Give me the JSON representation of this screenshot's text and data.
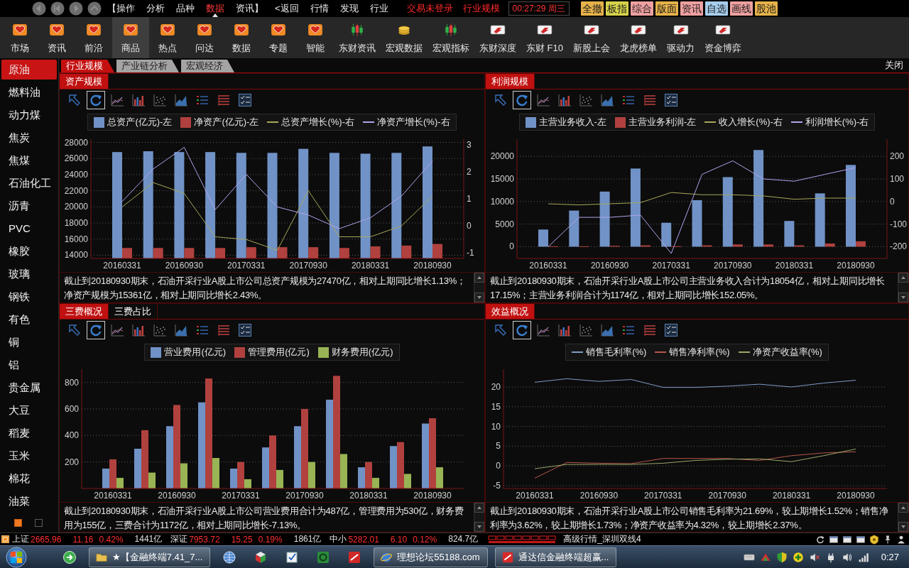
{
  "menubar": {
    "menu": [
      {
        "label": "【操作",
        "selected": false
      },
      {
        "label": "分析",
        "selected": false
      },
      {
        "label": "品种",
        "selected": false
      },
      {
        "label": "数据",
        "selected": true
      },
      {
        "label": "资讯】",
        "selected": false
      },
      {
        "label": "<返回",
        "selected": false
      },
      {
        "label": "行情",
        "selected": false
      },
      {
        "label": "发现",
        "selected": false
      },
      {
        "label": "行业",
        "selected": false
      }
    ],
    "alerts": [
      "交易未登录",
      "行业规模"
    ],
    "clock": "00:27:29 周三",
    "quick_buttons": [
      {
        "label": "全撤",
        "color": "#e6b24a"
      },
      {
        "label": "板指",
        "color": "#d6d24a"
      },
      {
        "label": "综合",
        "color": "#eea0a0"
      },
      {
        "label": "版面",
        "color": "#e6b24a"
      },
      {
        "label": "资讯",
        "color": "#eea0a0"
      },
      {
        "label": "自选",
        "color": "#a6cdec"
      },
      {
        "label": "画线",
        "color": "#eea0a0"
      },
      {
        "label": "股池",
        "color": "#e6b24a"
      }
    ]
  },
  "toolbar": [
    {
      "label": "市场",
      "kind": "module",
      "selected": false
    },
    {
      "label": "资讯",
      "kind": "module",
      "selected": false
    },
    {
      "label": "前沿",
      "kind": "module",
      "selected": false
    },
    {
      "label": "商品",
      "kind": "module",
      "selected": true
    },
    {
      "label": "热点",
      "kind": "module",
      "selected": false
    },
    {
      "label": "问达",
      "kind": "module",
      "selected": false
    },
    {
      "label": "数据",
      "kind": "module",
      "selected": false
    },
    {
      "label": "专题",
      "kind": "module",
      "selected": false
    },
    {
      "label": "智能",
      "kind": "module",
      "selected": false
    },
    {
      "label": "东财资讯",
      "kind": "chart",
      "selected": false
    },
    {
      "label": "宏观数据",
      "kind": "money",
      "selected": false
    },
    {
      "label": "宏观指标",
      "kind": "chart",
      "selected": false
    },
    {
      "label": "东财深度",
      "kind": "plugin",
      "selected": false
    },
    {
      "label": "东财 F10",
      "kind": "plugin",
      "selected": false
    },
    {
      "label": "新股上会",
      "kind": "plugin",
      "selected": false
    },
    {
      "label": "龙虎榜单",
      "kind": "plugin",
      "selected": false
    },
    {
      "label": "驱动力",
      "kind": "plugin",
      "selected": false
    },
    {
      "label": "资金博弈",
      "kind": "plugin",
      "selected": false
    }
  ],
  "sidebar": {
    "items": [
      {
        "label": "原油",
        "selected": true
      },
      {
        "label": "燃料油",
        "selected": false
      },
      {
        "label": "动力煤",
        "selected": false
      },
      {
        "label": "焦炭",
        "selected": false
      },
      {
        "label": "焦煤",
        "selected": false
      },
      {
        "label": "石油化工",
        "selected": false
      },
      {
        "label": "沥青",
        "selected": false
      },
      {
        "label": "PVC",
        "selected": false
      },
      {
        "label": "橡胶",
        "selected": false
      },
      {
        "label": "玻璃",
        "selected": false
      },
      {
        "label": "钢铁",
        "selected": false
      },
      {
        "label": "有色",
        "selected": false
      },
      {
        "label": "铜",
        "selected": false
      },
      {
        "label": "铝",
        "selected": false
      },
      {
        "label": "贵金属",
        "selected": false
      },
      {
        "label": "大豆",
        "selected": false
      },
      {
        "label": "稻麦",
        "selected": false
      },
      {
        "label": "玉米",
        "selected": false
      },
      {
        "label": "棉花",
        "selected": false
      },
      {
        "label": "油菜",
        "selected": false
      }
    ],
    "pages": [
      {
        "selected": true
      },
      {
        "selected": false
      }
    ]
  },
  "tabs": [
    {
      "label": "行业规模",
      "selected": true
    },
    {
      "label": "产业链分析",
      "selected": false
    },
    {
      "label": "宏观经济",
      "selected": false
    }
  ],
  "close_button": "关闭",
  "panels": [
    {
      "tabs": [
        {
          "label": "资产规模",
          "selected": true
        }
      ],
      "tools": [
        {
          "selected": false
        },
        {
          "selected": true
        },
        {
          "selected": false
        },
        {
          "selected": false
        },
        {
          "selected": false
        },
        {
          "selected": false
        },
        {
          "selected": false
        },
        {
          "selected": false
        },
        {
          "selected": false
        }
      ],
      "chart_data": {
        "type": "bar",
        "legend": "top",
        "grid": true,
        "categories": [
          "20160331",
          null,
          "20160930",
          null,
          "20170331",
          null,
          "20170930",
          null,
          "20180331",
          null,
          "20180930"
        ],
        "ylim": [
          13600,
          28400
        ],
        "yticks": [
          14000,
          16000,
          18000,
          20000,
          22000,
          24000,
          26000,
          28000
        ],
        "y2lim": [
          -1.2,
          3.2
        ],
        "y2ticks": [
          -1,
          0,
          1,
          2,
          3
        ],
        "series": [
          {
            "name": "总资产(亿元)-左",
            "color": "#7092c6",
            "values": [
              26800,
              26900,
              26800,
              26800,
              26700,
              26700,
              27200,
              26700,
              26600,
              26700,
              27500
            ]
          },
          {
            "name": "净资产(亿元)-左",
            "color": "#b0413e",
            "values": [
              14900,
              14900,
              14900,
              14900,
              15000,
              15000,
              15000,
              14900,
              15100,
              15200,
              15400
            ]
          },
          {
            "name": "总资产增长(%)-右",
            "color": "#a8a85a",
            "type": "line",
            "axis": "y2",
            "values": [
              0.7,
              1.6,
              1.2,
              -0.4,
              -0.5,
              -0.9,
              1.3,
              -0.4,
              -0.4,
              0,
              1.1
            ]
          },
          {
            "name": "净资产增长(%)-右",
            "color": "#b2a2ec",
            "type": "line",
            "axis": "y2",
            "values": [
              0.9,
              2.1,
              2.9,
              0.6,
              1.9,
              0.7,
              0.4,
              -0.1,
              0.3,
              1.1,
              2.4
            ]
          }
        ]
      },
      "summary": "截止到20180930期末，石油开采行业A股上市公司总资产规模为27470亿，相对上期同比增长1.13%；净资产规模为15361亿，相对上期同比增长2.43%。"
    },
    {
      "tabs": [
        {
          "label": "利润规模",
          "selected": true
        }
      ],
      "tools": [
        {
          "selected": false
        },
        {
          "selected": true
        },
        {
          "selected": false
        },
        {
          "selected": false
        },
        {
          "selected": false
        },
        {
          "selected": false
        },
        {
          "selected": false
        },
        {
          "selected": false
        },
        {
          "selected": false
        }
      ],
      "chart_data": {
        "type": "bar",
        "legend": "top",
        "grid": true,
        "categories": [
          "20160331",
          null,
          "20160930",
          null,
          "20170331",
          null,
          "20170930",
          null,
          "20180331",
          null,
          "20180930"
        ],
        "ylim": [
          -2600,
          23800
        ],
        "yticks": [
          0,
          5000,
          10000,
          15000,
          20000
        ],
        "y2lim": [
          -252,
          276
        ],
        "y2ticks": [
          -200,
          -100,
          0,
          100,
          200
        ],
        "series": [
          {
            "name": "主营业务收入-左",
            "color": "#7092c6",
            "values": [
              3800,
              8000,
              12200,
              17300,
              5300,
              10300,
              15400,
              21400,
              5700,
              11800,
              18100
            ]
          },
          {
            "name": "主营业务利润-左",
            "color": "#b0413e",
            "values": [
              100,
              100,
              200,
              300,
              100,
              300,
              500,
              500,
              300,
              700,
              1200
            ]
          },
          {
            "name": "收入增长(%)-右",
            "color": "#a8a85a",
            "type": "line",
            "axis": "y2",
            "values": [
              -10,
              -15,
              -10,
              -5,
              40,
              30,
              30,
              25,
              10,
              15,
              15
            ]
          },
          {
            "name": "利润增长(%)-右",
            "color": "#b2a2ec",
            "type": "line",
            "axis": "y2",
            "values": [
              -200,
              -70,
              -70,
              -60,
              -230,
              120,
              180,
              100,
              90,
              120,
              150
            ]
          }
        ]
      },
      "summary": "截止到20180930期末，石油开采行业A股上市公司主营业务收入合计为18054亿，相对上期同比增长17.15%；主营业务利润合计为1174亿，相对上期同比增长152.05%。"
    },
    {
      "tabs": [
        {
          "label": "三费概况",
          "selected": true
        },
        {
          "label": "三费占比",
          "selected": false
        }
      ],
      "tools": [
        {
          "selected": false
        },
        {
          "selected": true
        },
        {
          "selected": false
        },
        {
          "selected": false
        },
        {
          "selected": false
        },
        {
          "selected": false
        },
        {
          "selected": false
        },
        {
          "selected": false
        },
        {
          "selected": false
        }
      ],
      "chart_data": {
        "type": "bar",
        "legend": "top",
        "grid": true,
        "categories": [
          "20160331",
          null,
          "20160930",
          null,
          "20170331",
          null,
          "20170930",
          null,
          "20180331",
          null,
          "20180930"
        ],
        "ylim": [
          0,
          900
        ],
        "yticks": [
          200,
          400,
          600,
          800
        ],
        "series": [
          {
            "name": "营业费用(亿元)",
            "color": "#7092c6",
            "values": [
              150,
              300,
              470,
              650,
              150,
              310,
              470,
              670,
              160,
              320,
              490
            ]
          },
          {
            "name": "管理费用(亿元)",
            "color": "#b0413e",
            "values": [
              220,
              440,
              630,
              830,
              200,
              400,
              600,
              850,
              200,
              350,
              530
            ]
          },
          {
            "name": "财务费用(亿元)",
            "color": "#98b454",
            "values": [
              80,
              120,
              190,
              230,
              70,
              140,
              200,
              260,
              80,
              110,
              160
            ]
          }
        ]
      },
      "summary": "截止到20180930期末，石油开采行业A股上市公司营业费用合计为487亿，管理费用为530亿，财务费用为155亿，三费合计为1172亿，相对上期同比增长-7.13%。"
    },
    {
      "tabs": [
        {
          "label": "效益概况",
          "selected": true
        }
      ],
      "tools": [
        {
          "selected": false
        },
        {
          "selected": true
        },
        {
          "selected": false
        },
        {
          "selected": false
        },
        {
          "selected": false
        },
        {
          "selected": false
        },
        {
          "selected": false
        },
        {
          "selected": false
        },
        {
          "selected": false
        }
      ],
      "chart_data": {
        "type": "line",
        "legend": "top",
        "grid": true,
        "categories": [
          "20160331",
          null,
          "20160930",
          null,
          "20170331",
          null,
          "20170930",
          null,
          "20180331",
          null,
          "20180930"
        ],
        "ylim": [
          -5.7,
          24.5
        ],
        "yticks": [
          -5,
          0,
          5,
          10,
          15,
          20
        ],
        "series": [
          {
            "name": "销售毛利率(%)",
            "color": "#7f9cc8",
            "values": [
              21.2,
              22.1,
              21.4,
              21.9,
              19.9,
              19.9,
              20.2,
              20.7,
              20.0,
              21.0,
              21.7
            ]
          },
          {
            "name": "销售净利率(%)",
            "color": "#b4584a",
            "values": [
              -3.1,
              0.9,
              0.7,
              0.6,
              1.9,
              1.9,
              1.9,
              1.4,
              2.6,
              3.3,
              3.6
            ]
          },
          {
            "name": "净资产收益率(%)",
            "color": "#9aa66a",
            "values": [
              -0.7,
              0.4,
              0.4,
              0.4,
              0.7,
              1.4,
              1.7,
              1.8,
              1.1,
              2.6,
              4.3
            ]
          }
        ]
      },
      "summary": "截止到20180930期末，石油开采行业A股上市公司销售毛利率为21.69%，较上期增长1.52%；销售净利率为3.62%，较上期增长1.73%；净资产收益率为4.32%，较上期增长2.37%。"
    }
  ],
  "status_bar": {
    "indices": [
      {
        "name": "上证",
        "price": "2665.96",
        "change": "11.16",
        "percent": "0.42%",
        "turnover": "1441亿",
        "up": true
      },
      {
        "name": "深证",
        "price": "7953.72",
        "change": "15.25",
        "percent": "0.19%",
        "turnover": "1861亿",
        "up": true
      },
      {
        "name": "中小",
        "price": "5282.01",
        "change": "6.10",
        "percent": "0.12%",
        "turnover": "824.7亿",
        "up": true
      }
    ],
    "feed": "高级行情_深圳双线4"
  },
  "taskbar": {
    "items": [
      {
        "kind": "app"
      },
      {
        "kind": "folder",
        "label": "★【金融终端7.41_7..."
      },
      {
        "kind": "app"
      },
      {
        "kind": "app"
      },
      {
        "kind": "app"
      },
      {
        "kind": "app"
      },
      {
        "kind": "app"
      },
      {
        "kind": "browser",
        "label": "理想论坛55188.com"
      },
      {
        "kind": "terminal",
        "label": "通达信金融终端超赢..."
      }
    ],
    "clock": "0:27"
  }
}
